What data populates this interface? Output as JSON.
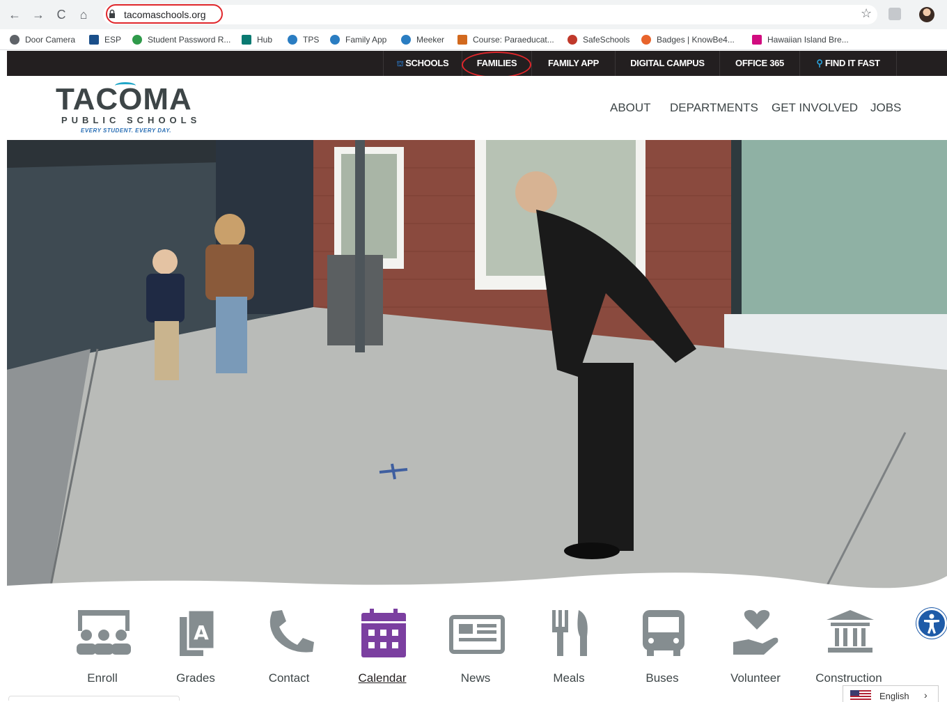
{
  "browser": {
    "url": "tacomaschools.org",
    "back_icon": "arrow-left-icon",
    "forward_icon": "arrow-right-icon",
    "reload_icon": "reload-icon",
    "home_icon": "home-icon",
    "bookmark_star": "star-icon"
  },
  "bookmarks": [
    {
      "label": "Door Camera",
      "color": "#5f6368"
    },
    {
      "label": "ESP",
      "color": "#1a4f8a"
    },
    {
      "label": "Student Password R...",
      "color": "#2f9a4a"
    },
    {
      "label": "Hub",
      "color": "#0a7a72"
    },
    {
      "label": "TPS",
      "color": "#2a7dc2"
    },
    {
      "label": "Family App",
      "color": "#2a7dc2"
    },
    {
      "label": "Meeker",
      "color": "#2a7dc2"
    },
    {
      "label": "Course: Paraeducat...",
      "color": "#d2691e"
    },
    {
      "label": "SafeSchools",
      "color": "#c0392b"
    },
    {
      "label": "Badges | KnowBe4...",
      "color": "#e8642c"
    },
    {
      "label": "Hawaiian Island Bre...",
      "color": "#d10c7f"
    }
  ],
  "topbar": {
    "schools": "SCHOOLS",
    "families": "FAMILIES",
    "family_app": "FAMILY APP",
    "digital_campus": "DIGITAL CAMPUS",
    "office365": "OFFICE 365",
    "find_it_fast": "FIND IT FAST"
  },
  "logo": {
    "name": "TACOMA",
    "sub": "PUBLIC SCHOOLS",
    "tagline": "EVERY STUDENT. EVERY DAY."
  },
  "mainnav": {
    "about": "ABOUT",
    "departments": "DEPARTMENTS",
    "get_involved": "GET INVOLVED",
    "jobs": "JOBS"
  },
  "quicklinks": [
    {
      "label": "Enroll",
      "icon": "classroom-icon"
    },
    {
      "label": "Grades",
      "icon": "grade-document-icon"
    },
    {
      "label": "Contact",
      "icon": "phone-icon"
    },
    {
      "label": "Calendar",
      "icon": "calendar-icon"
    },
    {
      "label": "News",
      "icon": "newspaper-icon"
    },
    {
      "label": "Meals",
      "icon": "fork-knife-icon"
    },
    {
      "label": "Buses",
      "icon": "bus-icon"
    },
    {
      "label": "Volunteer",
      "icon": "heart-hand-icon"
    },
    {
      "label": "Construction",
      "icon": "building-icon"
    }
  ],
  "language": {
    "label": "English"
  },
  "colors": {
    "brand_dark": "#231f20",
    "brand_purple": "#7b3fa0",
    "annotation_red": "#e0262b"
  }
}
